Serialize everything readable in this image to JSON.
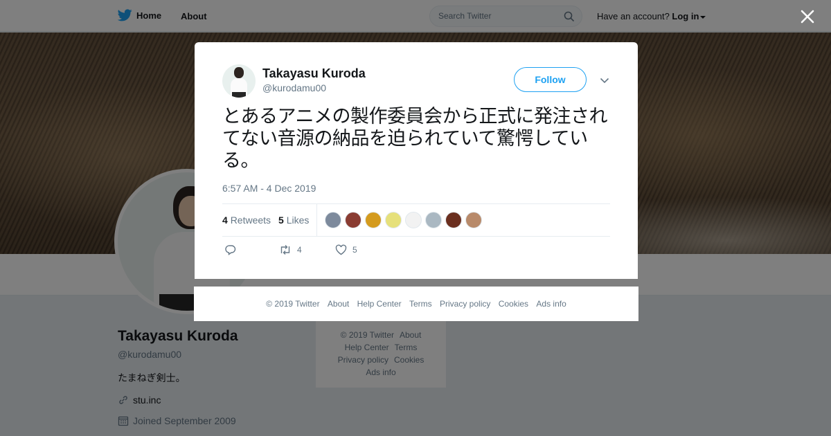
{
  "topbar": {
    "home_label": "Home",
    "about_label": "About",
    "search_placeholder": "Search Twitter",
    "account_prompt": "Have an account?",
    "login_label": "Log in"
  },
  "profile": {
    "name": "Takayasu Kuroda",
    "handle": "@kurodamu00",
    "bio": "たまねぎ剣士。",
    "website": "stu.inc",
    "joined": "Joined September 2009"
  },
  "side_footer": {
    "links": [
      "© 2019 Twitter",
      "About",
      "Help Center",
      "Terms",
      "Privacy policy",
      "Cookies",
      "Ads info"
    ]
  },
  "tweet": {
    "author_name": "Takayasu Kuroda",
    "author_handle": "@kurodamu00",
    "follow_label": "Follow",
    "text": "とあるアニメの製作委員会から正式に発注されてない音源の納品を迫られていて驚愕している。",
    "timestamp": "6:57 AM - 4 Dec 2019",
    "retweet_count": "4",
    "retweet_label": "Retweets",
    "like_count": "5",
    "like_label": "Likes",
    "reply_count": "",
    "action_retweet_count": "4",
    "action_like_count": "5",
    "liker_colors": [
      "#7d8a9c",
      "#8a3c32",
      "#d49b1e",
      "#e6e07a",
      "#f2f2f2",
      "#aab8c2",
      "#6b2f1f",
      "#b88a6a"
    ]
  },
  "modal_footer": {
    "links": [
      "© 2019 Twitter",
      "About",
      "Help Center",
      "Terms",
      "Privacy policy",
      "Cookies",
      "Ads info"
    ]
  },
  "colors": {
    "accent": "#1da1f2",
    "secondary_text": "#657786"
  },
  "icons": {
    "brand": "twitter-bird-icon",
    "close": "close-icon",
    "search": "search-icon",
    "reply": "reply-icon",
    "retweet": "retweet-icon",
    "like": "heart-icon",
    "link": "link-icon",
    "calendar": "calendar-icon"
  }
}
